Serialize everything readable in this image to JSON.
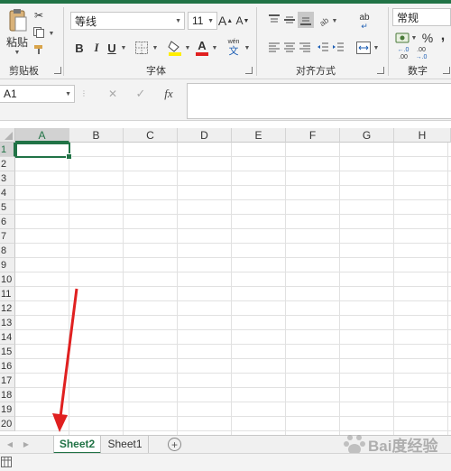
{
  "ribbon": {
    "clipboard": {
      "paste_label": "粘贴",
      "group_label": "剪贴板"
    },
    "font": {
      "font_name": "等线",
      "font_size": "11",
      "grow_glyph": "A",
      "shrink_glyph": "A",
      "bold": "B",
      "italic": "I",
      "underline": "U",
      "font_color_glyph": "A",
      "phonetic_glyph": "wén",
      "group_label": "字体"
    },
    "alignment": {
      "wrap_glyph": "ab",
      "group_label": "对齐方式"
    },
    "number": {
      "format": "常规",
      "percent": "%",
      "comma": ",",
      "inc_decimal": "←.0\n.00",
      "dec_decimal": ".00\n→.0",
      "group_label": "数字"
    }
  },
  "formula_bar": {
    "name_box": "A1",
    "cancel_glyph": "✕",
    "enter_glyph": "✓",
    "fx_label": "fx",
    "formula": ""
  },
  "grid": {
    "columns": [
      "A",
      "B",
      "C",
      "D",
      "E",
      "F",
      "G",
      "H"
    ],
    "rows": [
      "1",
      "2",
      "3",
      "4",
      "5",
      "6",
      "7",
      "8",
      "9",
      "10",
      "11",
      "12",
      "13",
      "14",
      "15",
      "16",
      "17",
      "18",
      "19",
      "20"
    ],
    "selected_column": "A",
    "selected_row": "1"
  },
  "sheets": {
    "tabs": [
      "Sheet2",
      "Sheet1"
    ],
    "active": "Sheet2",
    "add_glyph": "+"
  },
  "watermark": "Bai度经验",
  "colors": {
    "accent": "#217346",
    "arrow": "#e02020"
  }
}
